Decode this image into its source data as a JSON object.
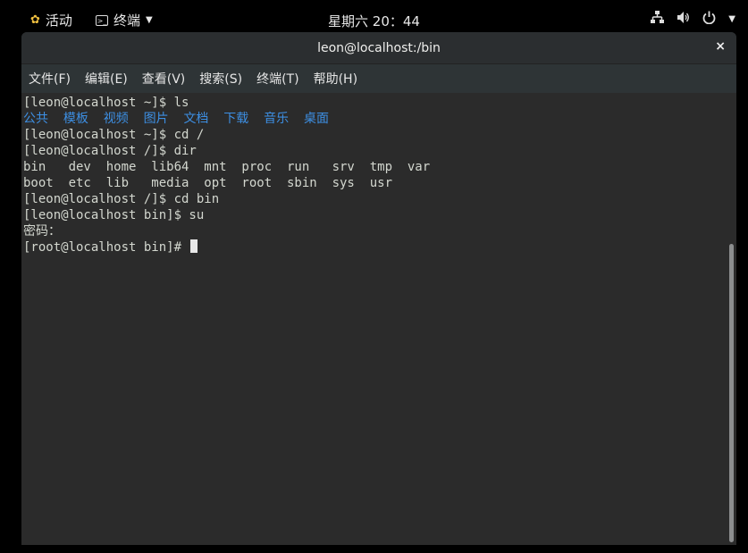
{
  "topbar": {
    "activities": "活动",
    "app_name": "终端",
    "clock": "星期六 20：44",
    "tray_icons": [
      "network-icon",
      "volume-icon",
      "power-icon"
    ]
  },
  "window": {
    "title": "leon@localhost:/bin",
    "close": "×",
    "menu": [
      "文件(F)",
      "编辑(E)",
      "查看(V)",
      "搜索(S)",
      "终端(T)",
      "帮助(H)"
    ]
  },
  "terminal": {
    "line1": "[leon@localhost ~]$ ls",
    "dirs_cn": [
      "公共",
      "模板",
      "视频",
      "图片",
      "文档",
      "下载",
      "音乐",
      "桌面"
    ],
    "line3": "[leon@localhost ~]$ cd /",
    "line4": "[leon@localhost /]$ dir",
    "line5": "bin   dev  home  lib64  mnt  proc  run   srv  tmp  var",
    "line6": "boot  etc  lib   media  opt  root  sbin  sys  usr",
    "line7": "[leon@localhost /]$ cd bin",
    "line8": "[leon@localhost bin]$ su",
    "line9": "密码：",
    "line10": "[root@localhost bin]# "
  },
  "colors": {
    "accent_blue": "#3d8fe3",
    "terminal_bg": "#2b2b2b",
    "topbar_bg": "#000000"
  }
}
